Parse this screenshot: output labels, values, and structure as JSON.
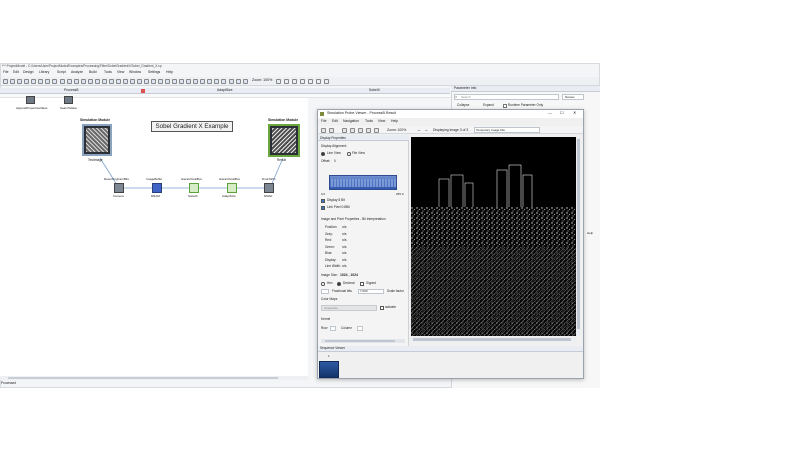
{
  "window": {
    "title": "*** ProjectModel - C:/Users/User/ProjectModel/Examples/Processing/Filter/SobelGradientX/Sobel_Gradient_X.cp",
    "status": "Processed"
  },
  "menubar": [
    "File",
    "Edit",
    "Design",
    "Library",
    "Script",
    "Analyze",
    "Build",
    "Tools",
    "View",
    "Window",
    "Settings",
    "Help"
  ],
  "toolbar": {
    "zoom_label": "Zoom: 100%"
  },
  "tabs": [
    {
      "label": "ProcessB"
    },
    {
      "label": "AdaptSize"
    },
    {
      "label": "SobelX"
    }
  ],
  "canvas": {
    "title_box": "Sobel Gradient X Example",
    "nodes": [
      {
        "label": "AppendPropertiesValue",
        "sublabel": ""
      },
      {
        "label": "SearchValue",
        "sublabel": ""
      },
      {
        "label": "Simulation Module",
        "sublabel": "TestImage"
      },
      {
        "label": "Simulation Module",
        "sublabel": "Result"
      },
      {
        "label": "ResetOrigCamBits",
        "sublabel": "Camera"
      },
      {
        "label": "ImageBuffer",
        "sublabel": "DRAM"
      },
      {
        "label": "HierarchicalBox",
        "sublabel": "SobelX"
      },
      {
        "label": "HierarchicalBox",
        "sublabel": "AdaptSize"
      },
      {
        "label": "DmaToPC",
        "sublabel": "DMA0"
      }
    ]
  },
  "params_panel": {
    "title": "Parameter Info",
    "search_placeholder": "Search",
    "dropdown": "Names",
    "collapse_btn": "Collapse",
    "expand_btn": "Expand",
    "runtime_label": "Runtime Parameter Only",
    "help_label": "Help"
  },
  "probe_window": {
    "title": "Simulation Probe Viewer - ProcessB.Result",
    "menu": [
      "File",
      "Edit",
      "Navigation",
      "Tools",
      "View",
      "Help"
    ],
    "zoom_label": "Zoom: 100%",
    "displaying_label": "Displaying image 3 of 3",
    "field_value": "Temporary Image File",
    "display_properties": {
      "header": "Display Properties",
      "display_alignment": "Display Alignment",
      "line_view": "Line View",
      "file_view": "File View",
      "offset_label": "Offset:",
      "offset_value": "0",
      "histogram_min": "0.0",
      "histogram_max": "255.0",
      "display_8bit": "Display 8 Bit",
      "link_pixel": "Link Pixel 0:8Bit",
      "section_title": "Image and Pixel Properties - Bit Interpretation",
      "props": [
        {
          "k": "Position:",
          "v": "n/a"
        },
        {
          "k": "Gray:",
          "v": "n/a"
        },
        {
          "k": "Red:",
          "v": "n/a"
        },
        {
          "k": "Green:",
          "v": "n/a"
        },
        {
          "k": "Blue:",
          "v": "n/a"
        },
        {
          "k": "Display:",
          "v": "n/a"
        },
        {
          "k": "Line Width:",
          "v": "n/a"
        }
      ],
      "image_size_label": "Image Size:",
      "image_size_value": "1024 , 1024",
      "hex_label": "Hex",
      "decimal_label": "Decimal",
      "signed_label": "Signed",
      "fractional_bits_label": "Fractional bits",
      "fractional_bits_value": "7.000",
      "scale_factor_label": "Scale factor",
      "color_maps_label": "Color Maps",
      "color_maps_value": "Grayscale",
      "activate_label": "activate",
      "kernel_label": "Kernel",
      "row_label": "Row",
      "column_label": "Column"
    },
    "sequence_viewer": {
      "title": "Sequence Viewer",
      "index": "1"
    }
  },
  "colors": {
    "accent": "#3a78c8",
    "green_node": "#5ea23a",
    "probe_title": "#ffffff",
    "panel_bg": "#f0f0f0"
  }
}
